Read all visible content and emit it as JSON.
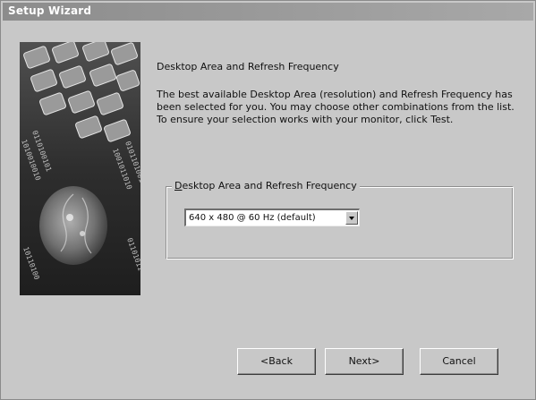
{
  "window": {
    "title": "Setup Wizard"
  },
  "content": {
    "heading": "Desktop Area and Refresh Frequency",
    "description": "The best available Desktop Area (resolution) and Refresh Frequency has been selected for you.  You may choose other combinations from the list.  To ensure your selection works with your monitor, click Test."
  },
  "group": {
    "legend_prefix": "",
    "legend_underlined": "D",
    "legend_rest": "esktop Area and Refresh Frequency",
    "combo_value": "640 x 480 @ 60 Hz (default)"
  },
  "buttons": {
    "back": "<Back",
    "next": "Next>",
    "cancel": "Cancel"
  },
  "icons": {
    "dropdown": "chevron-down-icon",
    "wizard_art": "keyboard-binary-head-illustration"
  },
  "colors": {
    "dialog_bg": "#c8c8c8",
    "titlebar": "#8c8c8c",
    "title_text": "#ffffff"
  }
}
